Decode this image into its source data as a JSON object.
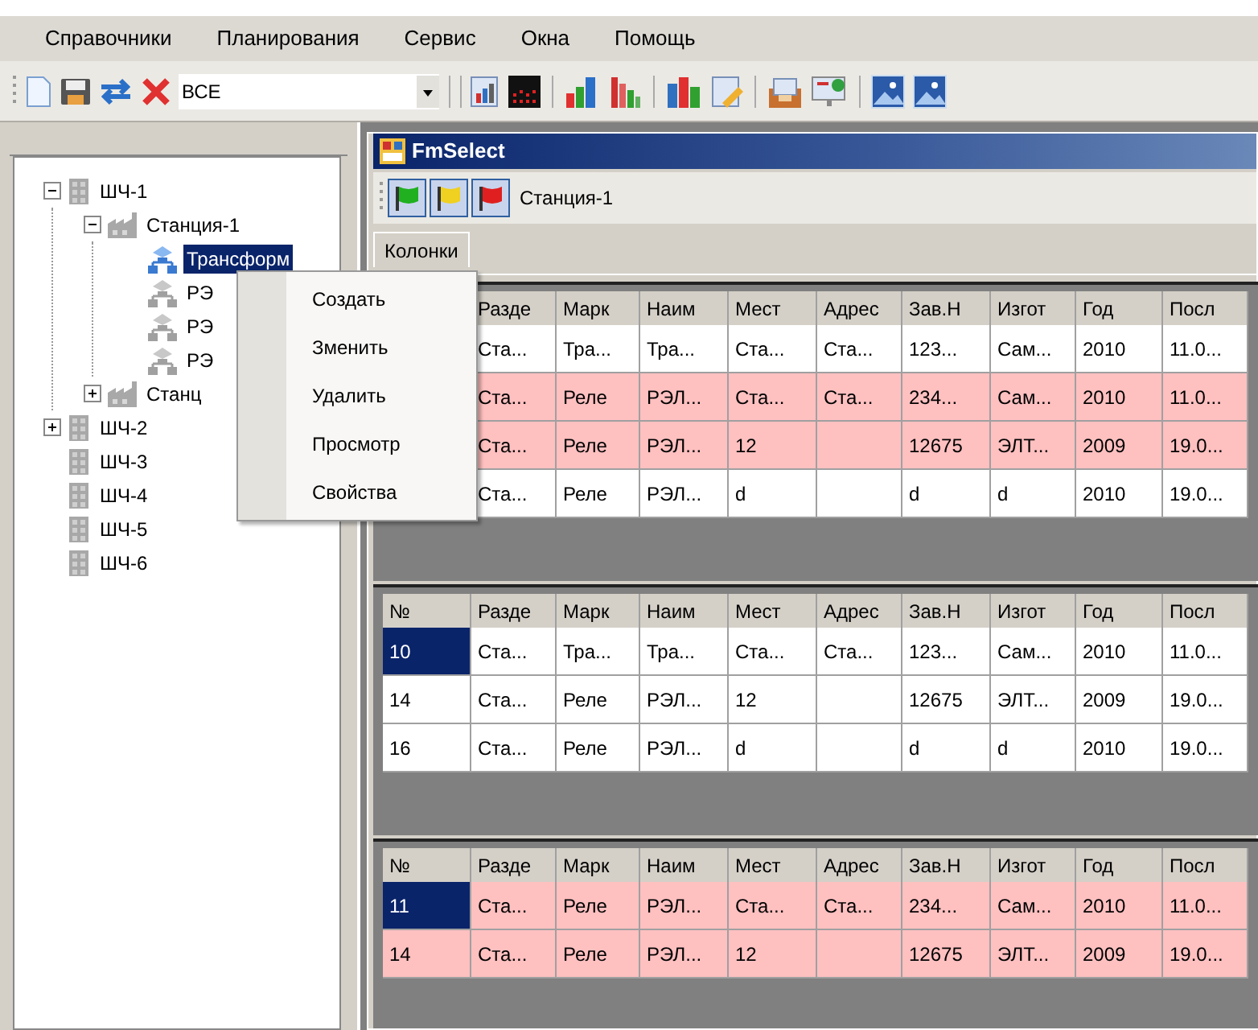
{
  "menu": [
    "Справочники",
    "Планирования",
    "Сервис",
    "Окна",
    "Помощь"
  ],
  "toolbar": {
    "filter": {
      "value": "ВСЕ"
    }
  },
  "tree": [
    {
      "label": "ШЧ-1",
      "kind": "district",
      "expanded": true,
      "selected": false,
      "children": [
        {
          "label": "Станция-1",
          "kind": "station",
          "expanded": true,
          "selected": false,
          "children": [
            {
              "label": "Трансформ",
              "kind": "device",
              "selected": true
            },
            {
              "label": "РЭ",
              "kind": "device",
              "selected": false
            },
            {
              "label": "РЭ",
              "kind": "device",
              "selected": false
            },
            {
              "label": "РЭ",
              "kind": "device",
              "selected": false
            }
          ]
        },
        {
          "label": "Станц",
          "kind": "station",
          "expanded": false,
          "selected": false
        }
      ]
    },
    {
      "label": "ШЧ-2",
      "kind": "district",
      "expanded": false,
      "selected": false
    },
    {
      "label": "ШЧ-3",
      "kind": "district",
      "selected": false
    },
    {
      "label": "ШЧ-4",
      "kind": "district",
      "selected": false
    },
    {
      "label": "ШЧ-5",
      "kind": "district",
      "selected": false
    },
    {
      "label": "ШЧ-6",
      "kind": "district",
      "selected": false
    }
  ],
  "context_menu": [
    "Создать",
    "Зменить",
    "Удалить",
    "Просмотр",
    "Свойства"
  ],
  "window": {
    "title": "FmSelect",
    "station": "Станция-1",
    "tab": "Колонки"
  },
  "grids": [
    {
      "columns": [
        null,
        "Разде",
        "Марк",
        "Наим",
        "Мест",
        "Адрес",
        "Зав.Н",
        "Изгот",
        "Год",
        "Посл"
      ],
      "rows": [
        {
          "highlighted": false,
          "cells": [
            null,
            "Ста...",
            "Тра...",
            "Тра...",
            "Ста...",
            "Ста...",
            "123...",
            "Сам...",
            "2010",
            "11.0..."
          ]
        },
        {
          "highlighted": true,
          "cells": [
            null,
            "Ста...",
            "Реле",
            "РЭЛ...",
            "Ста...",
            "Ста...",
            "234...",
            "Сам...",
            "2010",
            "11.0..."
          ]
        },
        {
          "highlighted": true,
          "cells": [
            null,
            "Ста...",
            "Реле",
            "РЭЛ...",
            "12",
            null,
            "12675",
            "ЭЛТ...",
            "2009",
            "19.0..."
          ]
        },
        {
          "highlighted": false,
          "cells": [
            null,
            "Ста...",
            "Реле",
            "РЭЛ...",
            "d",
            null,
            "d",
            "d",
            "2010",
            "19.0..."
          ]
        }
      ]
    },
    {
      "columns": [
        "№",
        "Разде",
        "Марк",
        "Наим",
        "Мест",
        "Адрес",
        "Зав.Н",
        "Изгот",
        "Год",
        "Посл"
      ],
      "rows": [
        {
          "highlighted": false,
          "selected": true,
          "cells": [
            "10",
            "Ста...",
            "Тра...",
            "Тра...",
            "Ста...",
            "Ста...",
            "123...",
            "Сам...",
            "2010",
            "11.0..."
          ]
        },
        {
          "highlighted": false,
          "selected": false,
          "cells": [
            "14",
            "Ста...",
            "Реле",
            "РЭЛ...",
            "12",
            null,
            "12675",
            "ЭЛТ...",
            "2009",
            "19.0..."
          ]
        },
        {
          "highlighted": false,
          "selected": false,
          "cells": [
            "16",
            "Ста...",
            "Реле",
            "РЭЛ...",
            "d",
            null,
            "d",
            "d",
            "2010",
            "19.0..."
          ]
        }
      ]
    },
    {
      "columns": [
        "№",
        "Разде",
        "Марк",
        "Наим",
        "Мест",
        "Адрес",
        "Зав.Н",
        "Изгот",
        "Год",
        "Посл"
      ],
      "rows": [
        {
          "highlighted": true,
          "selected": true,
          "cells": [
            "11",
            "Ста...",
            "Реле",
            "РЭЛ...",
            "Ста...",
            "Ста...",
            "234...",
            "Сам...",
            "2010",
            "11.0..."
          ]
        },
        {
          "highlighted": true,
          "selected": false,
          "cells": [
            "14",
            "Ста...",
            "Реле",
            "РЭЛ...",
            "12",
            null,
            "12675",
            "ЭЛТ...",
            "2009",
            "19.0..."
          ]
        }
      ]
    }
  ]
}
